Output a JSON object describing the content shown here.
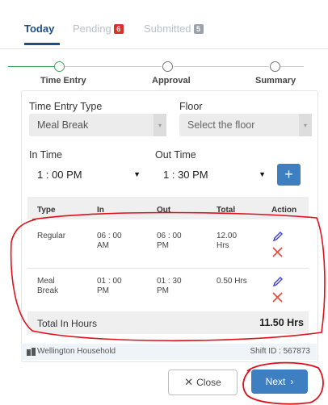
{
  "tabs": [
    {
      "label": "Today"
    },
    {
      "label": "Pending",
      "badge": "6",
      "badge_color": "#d9302c"
    },
    {
      "label": "Submitted",
      "badge": "5",
      "badge_color": "#9aa3ab"
    }
  ],
  "stepper": {
    "steps": [
      {
        "label": "Time Entry"
      },
      {
        "label": "Approval"
      },
      {
        "label": "Summary"
      }
    ]
  },
  "form": {
    "time_entry_type_label": "Time Entry Type",
    "time_entry_type_value": "Meal Break",
    "floor_label": "Floor",
    "floor_placeholder": "Select the floor",
    "in_time_label": "In Time",
    "in_time_value": "1 : 00 PM",
    "out_time_label": "Out Time",
    "out_time_value": "1 : 30 PM",
    "add_icon": "plus-icon"
  },
  "table": {
    "headers": [
      "Type",
      "In",
      "Out",
      "Total",
      "Action"
    ],
    "rows": [
      {
        "type": [
          "Regular",
          ""
        ],
        "in": [
          "06 : 00",
          "AM"
        ],
        "out": [
          "06 : 00",
          "PM"
        ],
        "total": [
          "12.00",
          "Hrs"
        ]
      },
      {
        "type": [
          "Meal",
          "Break"
        ],
        "in": [
          "01 : 00",
          "PM"
        ],
        "out": [
          "01 : 30",
          "PM"
        ],
        "total": [
          "0.50 Hrs",
          ""
        ]
      }
    ],
    "total_label": "Total In Hours",
    "total_value": "11.50 Hrs"
  },
  "footer": {
    "household": "Wellington Household",
    "shift_id": "Shift ID : 567873"
  },
  "buttons": {
    "close": "Close",
    "next": "Next"
  },
  "colors": {
    "primary": "#3d7fc1",
    "success": "#3aa55a",
    "annotation": "#e0101b"
  }
}
